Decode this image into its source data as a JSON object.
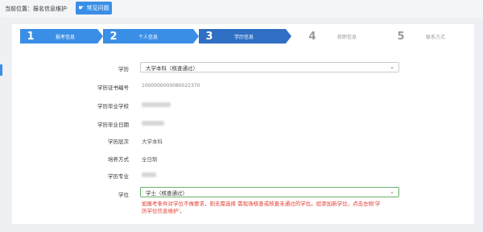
{
  "header": {
    "breadcrumb": "当前位置：报名信息维护",
    "faq_button": "常见问题",
    "faq_icon": "hand-pointer-icon"
  },
  "steps": [
    {
      "num": "1",
      "label": "报考信息",
      "state": "done"
    },
    {
      "num": "2",
      "label": "个人信息",
      "state": "done"
    },
    {
      "num": "3",
      "label": "学历信息",
      "state": "active"
    },
    {
      "num": "4",
      "label": "就职信息",
      "state": "todo"
    },
    {
      "num": "5",
      "label": "联系方式",
      "state": "todo"
    }
  ],
  "form": {
    "education": {
      "label": "学历",
      "value": "大学本科（核查通过）"
    },
    "cert_no": {
      "label": "学历证书编号",
      "value": "1000000000080022370"
    },
    "school": {
      "label": "学历毕业学校"
    },
    "grad_date": {
      "label": "学历毕业日期"
    },
    "level": {
      "label": "学历层次",
      "value": "大学本科"
    },
    "mode": {
      "label": "培养方式",
      "value": "全日制"
    },
    "major": {
      "label": "学历专业"
    },
    "degree": {
      "label": "学位",
      "value": "学士（核查通过）"
    }
  },
  "warning": "如报考条件对学位不做要求，则无需选择 需现场核查或核查未通过的学位。如添加新学位，点击左侧'学历学位信息维护'。",
  "colors": {
    "accent": "#3a8ee6",
    "active": "#2f6fc4",
    "warning": "#e23a2e"
  }
}
